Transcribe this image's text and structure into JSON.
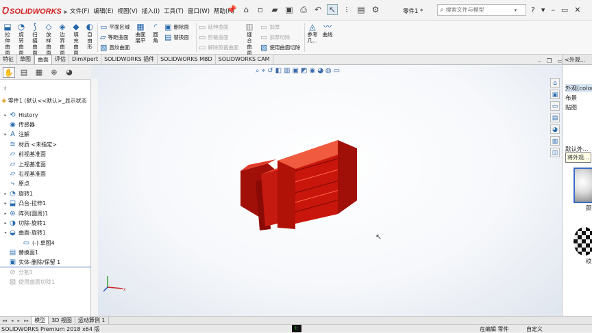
{
  "app": {
    "logo": "SOLIDWORKS",
    "part_name": "零件1 *"
  },
  "menu": [
    "文件(F)",
    "编辑(E)",
    "视图(V)",
    "插入(I)",
    "工具(T)",
    "窗口(W)",
    "帮助(H)"
  ],
  "search": {
    "placeholder": "搜索文件与模型"
  },
  "cmd_big": [
    {
      "label": "拉伸曲面",
      "icon": "extrude-surface-icon"
    },
    {
      "label": "旋转曲面",
      "icon": "revolve-surface-icon"
    },
    {
      "label": "扫描曲面",
      "icon": "sweep-surface-icon"
    },
    {
      "label": "放样曲面",
      "icon": "loft-surface-icon"
    },
    {
      "label": "边界曲面",
      "icon": "boundary-surface-icon"
    },
    {
      "label": "填充曲面",
      "icon": "fill-surface-icon"
    },
    {
      "label": "自由形",
      "icon": "freeform-icon"
    }
  ],
  "cmd_small": {
    "planar": "平面区域",
    "offset": "等距曲面",
    "ruled": "直纹曲面",
    "flatten": "曲面展平",
    "delete_face": "删除面",
    "replace_face": "替换面",
    "extend": "延伸曲面",
    "trim": "剪裁曲面",
    "untrim": "解除剪裁曲面",
    "knit": "缝合曲面",
    "thicken": "加厚",
    "thicken_cut": "加厚切除",
    "cut_surface": "使用曲面切除",
    "ref": "参考几...",
    "curve": "曲线"
  },
  "tabs": [
    "特征",
    "草图",
    "曲面",
    "评估",
    "DimXpert",
    "SOLIDWORKS 插件",
    "SOLIDWORKS MBD",
    "SOLIDWORKS CAM"
  ],
  "tree": {
    "root": "零件1 (默认<<默认>_显示状态",
    "items": [
      {
        "label": "History",
        "icon": "history-icon",
        "expand": "▸"
      },
      {
        "label": "传感器",
        "icon": "sensor-icon",
        "expand": ""
      },
      {
        "label": "注解",
        "icon": "annotation-icon",
        "expand": "▸"
      },
      {
        "label": "材质 <未指定>",
        "icon": "material-icon",
        "expand": ""
      },
      {
        "label": "前视基准面",
        "icon": "plane-icon",
        "expand": ""
      },
      {
        "label": "上视基准面",
        "icon": "plane-icon",
        "expand": ""
      },
      {
        "label": "右视基准面",
        "icon": "plane-icon",
        "expand": ""
      },
      {
        "label": "原点",
        "icon": "origin-icon",
        "expand": ""
      },
      {
        "label": "旋转1",
        "icon": "revolve-icon",
        "expand": "▸"
      },
      {
        "label": "凸台-拉伸1",
        "icon": "boss-extrude-icon",
        "expand": "▸"
      },
      {
        "label": "阵列(圆周)1",
        "icon": "circular-pattern-icon",
        "expand": "▸"
      },
      {
        "label": "切除-旋转1",
        "icon": "cut-revolve-icon",
        "expand": "▸"
      },
      {
        "label": "曲面-旋转1",
        "icon": "surface-revolve-icon",
        "expand": "▾"
      },
      {
        "label": "(-) 草图4",
        "icon": "sketch-icon",
        "expand": "",
        "indent": 2
      },
      {
        "label": "替换面1",
        "icon": "replace-face-icon",
        "expand": ""
      },
      {
        "label": "实体-删除/保留 1",
        "icon": "delete-body-icon",
        "expand": ""
      },
      {
        "label": "分割1",
        "icon": "split-icon",
        "expand": "",
        "dim": true
      },
      {
        "label": "使用曲面切除1",
        "icon": "surface-cut-icon",
        "expand": "",
        "dim": true
      }
    ]
  },
  "right_panel": {
    "header": "<外观...",
    "items": [
      "外观(color)",
      "布景",
      "贴图"
    ],
    "default_label": "默认外...",
    "tooltip": "将外观...",
    "swatch1_label": "颜",
    "swatch2_label": "纹"
  },
  "bottom_tabs": [
    "模型",
    "3D 视图",
    "运动算例 1"
  ],
  "status": {
    "left": "SOLIDWORKS Premium 2018 x64 版",
    "right": "在编辑 零件",
    "right2": "自定义"
  },
  "colors": {
    "part_red": "#d0140c",
    "part_dark": "#8a0a06",
    "part_light": "#ee3a2a",
    "accent": "#2266aa",
    "logo_red": "#d02020"
  }
}
